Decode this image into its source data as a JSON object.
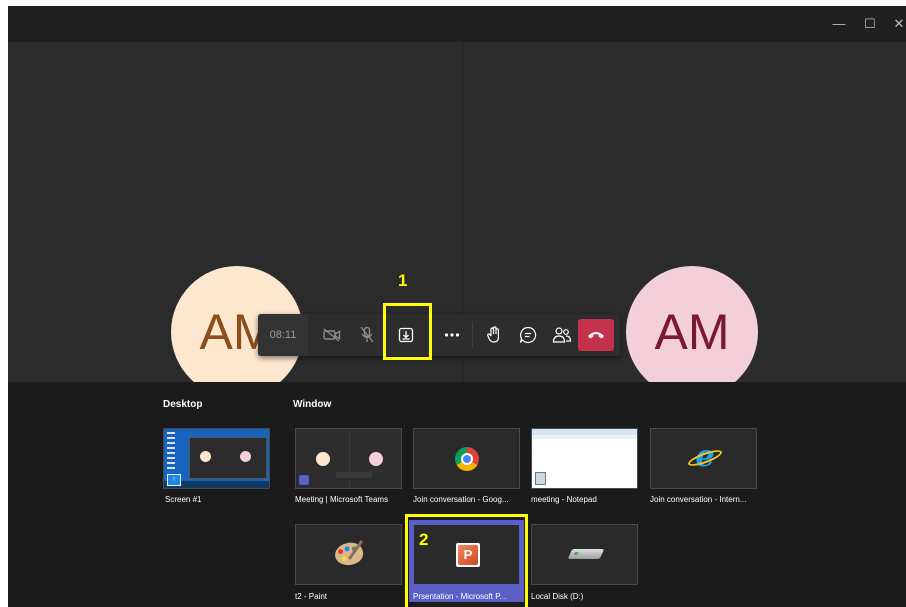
{
  "window": {
    "controls": {
      "minimize": "—",
      "maximize": "☐",
      "close": "✕"
    }
  },
  "participants": [
    {
      "initials": "AM",
      "side": "left",
      "bg": "#fde8cf",
      "fg": "#8a4f1d"
    },
    {
      "initials": "AM",
      "side": "right",
      "bg": "#f3cfd9",
      "fg": "#7a1935"
    }
  ],
  "controlbar": {
    "timer": "08:11",
    "buttons": [
      "camera-off",
      "mic-off",
      "share-content",
      "more-options",
      "raise-hand",
      "chat",
      "participants",
      "hang-up"
    ],
    "hangup_color": "#c4314b"
  },
  "annotations": {
    "step1": "1",
    "step2": "2",
    "color": "#ffff00"
  },
  "share_tray": {
    "desktop_heading": "Desktop",
    "window_heading": "Window",
    "desktop_items": [
      {
        "label": "Screen #1"
      }
    ],
    "window_items": [
      {
        "label": "Meeting | Microsoft Teams"
      },
      {
        "label": "Join conversation - Goog..."
      },
      {
        "label": "meeting - Notepad"
      },
      {
        "label": "Join conversation - Intern..."
      },
      {
        "label": "t2 - Paint"
      },
      {
        "label": "Prsentation - Microsoft P...",
        "selected": true
      },
      {
        "label": "Local Disk (D:)"
      }
    ],
    "selected_color": "#5b5fc7"
  }
}
